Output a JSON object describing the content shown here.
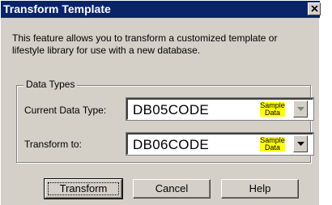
{
  "window": {
    "title": "Transform Template"
  },
  "description": "This feature allows you to transform a customized template or lifestyle library for use with a new database.",
  "group": {
    "legend": "Data Types",
    "current": {
      "label": "Current Data Type:",
      "value": "DB05CODE",
      "badge": "Sample Data",
      "enabled": false
    },
    "target": {
      "label": "Transform to:",
      "value": "DB06CODE",
      "badge": "Sample Data",
      "enabled": true
    }
  },
  "buttons": {
    "transform": "Transform",
    "cancel": "Cancel",
    "help": "Help"
  },
  "icons": {
    "close": "close-icon",
    "dropdown": "chevron-down-icon"
  },
  "colors": {
    "titlebar": "#0a246a",
    "dialog_face": "#d4d0c8",
    "badge": "#ffff00"
  }
}
